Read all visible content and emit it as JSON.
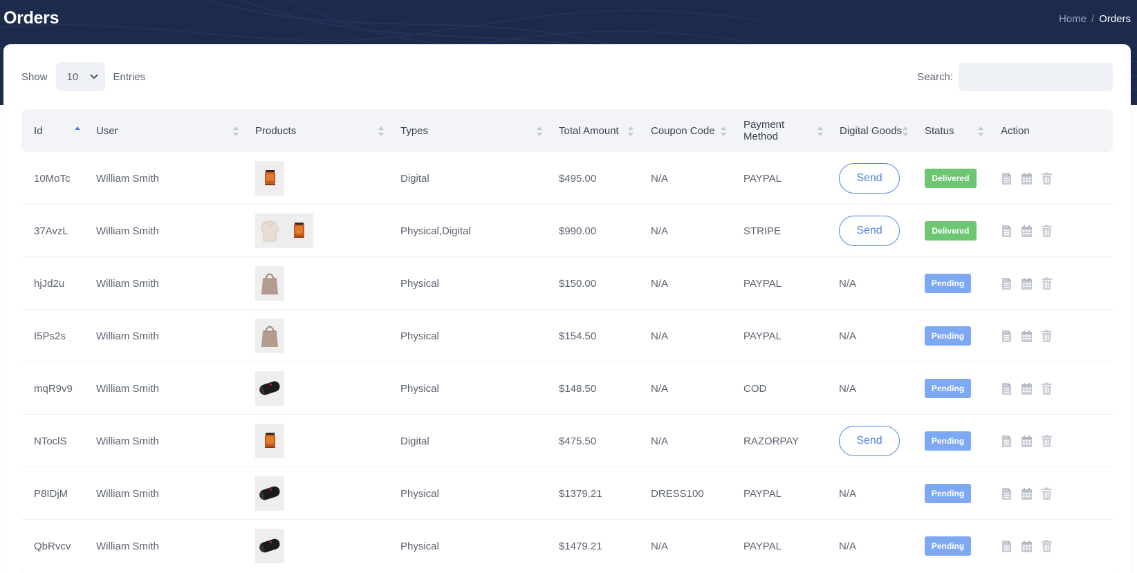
{
  "header": {
    "title": "Orders",
    "breadcrumb": {
      "home": "Home",
      "separator": "/",
      "current": "Orders"
    }
  },
  "controls": {
    "show_label": "Show",
    "entries_value": "10",
    "entries_label": "Entries",
    "search_label": "Search:",
    "search_value": ""
  },
  "table": {
    "columns": {
      "id": "Id",
      "user": "User",
      "products": "Products",
      "types": "Types",
      "total": "Total Amount",
      "coupon": "Coupon Code",
      "payment_line1": "Payment",
      "payment_line2": "Method",
      "digital": "Digital Goods",
      "status": "Status",
      "action": "Action"
    },
    "send_label": "Send",
    "rows": [
      {
        "id": "10MoTc",
        "user": "William Smith",
        "products": [
          "candle"
        ],
        "types": "Digital",
        "total": "$495.00",
        "coupon": "N/A",
        "payment": "PAYPAL",
        "digital": "send",
        "status": "Delivered"
      },
      {
        "id": "37AvzL",
        "user": "William Smith",
        "products": [
          "sweater",
          "candle"
        ],
        "types": "Physical,Digital",
        "total": "$990.00",
        "coupon": "N/A",
        "payment": "STRIPE",
        "digital": "send",
        "status": "Delivered"
      },
      {
        "id": "hjJd2u",
        "user": "William Smith",
        "products": [
          "bag"
        ],
        "types": "Physical",
        "total": "$150.00",
        "coupon": "N/A",
        "payment": "PAYPAL",
        "digital": "N/A",
        "status": "Pending"
      },
      {
        "id": "I5Ps2s",
        "user": "William Smith",
        "products": [
          "bag"
        ],
        "types": "Physical",
        "total": "$154.50",
        "coupon": "N/A",
        "payment": "PAYPAL",
        "digital": "N/A",
        "status": "Pending"
      },
      {
        "id": "mqR9v9",
        "user": "William Smith",
        "products": [
          "speaker"
        ],
        "types": "Physical",
        "total": "$148.50",
        "coupon": "N/A",
        "payment": "COD",
        "digital": "N/A",
        "status": "Pending"
      },
      {
        "id": "NToclS",
        "user": "William Smith",
        "products": [
          "candle"
        ],
        "types": "Digital",
        "total": "$475.50",
        "coupon": "N/A",
        "payment": "RAZORPAY",
        "digital": "send",
        "status": "Pending"
      },
      {
        "id": "P8IDjM",
        "user": "William Smith",
        "products": [
          "speaker"
        ],
        "types": "Physical",
        "total": "$1379.21",
        "coupon": "DRESS100",
        "payment": "PAYPAL",
        "digital": "N/A",
        "status": "Pending"
      },
      {
        "id": "QbRvcv",
        "user": "William Smith",
        "products": [
          "speaker"
        ],
        "types": "Physical",
        "total": "$1479.21",
        "coupon": "N/A",
        "payment": "PAYPAL",
        "digital": "N/A",
        "status": "Pending"
      }
    ]
  },
  "colors": {
    "header_bg": "#1c2a4b",
    "send_accent": "#4f7fe6",
    "delivered": "#6dc671",
    "pending": "#7fa8f3"
  },
  "icons": {
    "row_actions": [
      "document-icon",
      "calendar-icon",
      "trash-icon"
    ],
    "sort": "sort-arrows-icon",
    "select": "chevron-down-icon"
  }
}
